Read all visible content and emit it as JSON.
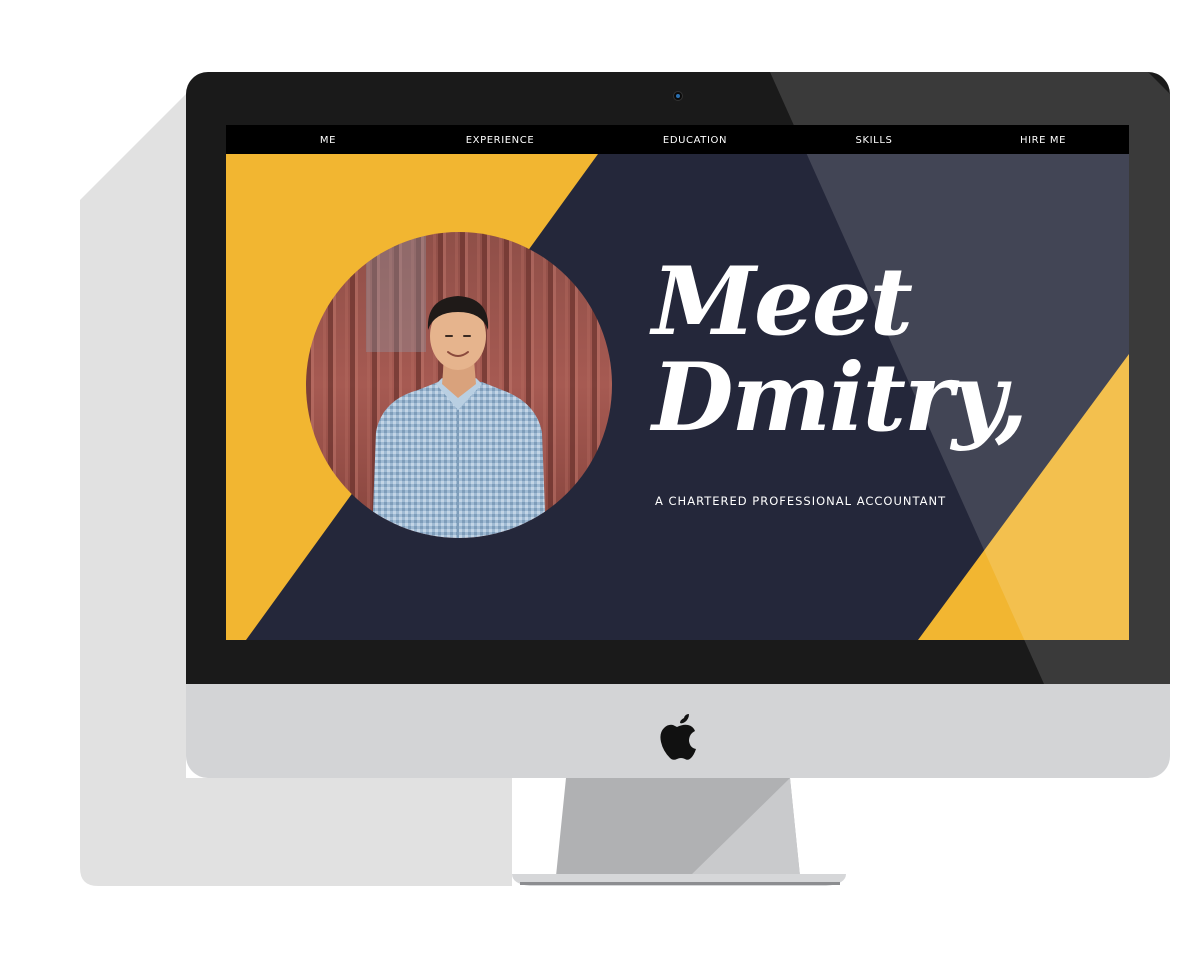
{
  "nav": {
    "items": [
      {
        "label": "ME"
      },
      {
        "label": "EXPERIENCE"
      },
      {
        "label": "EDUCATION"
      },
      {
        "label": "SKILLS"
      },
      {
        "label": "HIRE ME"
      }
    ]
  },
  "hero": {
    "headline_line1": "Meet",
    "headline_line2": "Dmitry,",
    "subtitle": "A CHARTERED PROFESSIONAL ACCOUNTANT"
  },
  "colors": {
    "navy": "#24273a",
    "yellow": "#f2b631",
    "nav_bg": "#000000",
    "bezel": "#1a1a1a",
    "chin": "#d3d4d6"
  },
  "icons": {
    "brand_logo": "apple-icon",
    "camera": "camera-icon"
  }
}
